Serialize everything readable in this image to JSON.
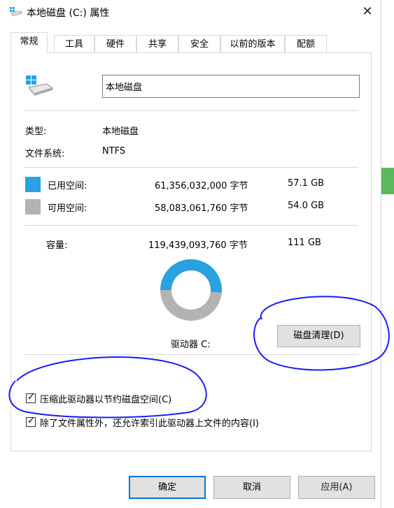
{
  "window": {
    "title": "本地磁盘 (C:) 属性",
    "close_glyph": "✕"
  },
  "tabs": [
    {
      "label": "常规"
    },
    {
      "label": "工具"
    },
    {
      "label": "硬件"
    },
    {
      "label": "共享"
    },
    {
      "label": "安全"
    },
    {
      "label": "以前的版本"
    },
    {
      "label": "配额"
    }
  ],
  "general": {
    "drive_name": "本地磁盘",
    "type_label": "类型:",
    "type_value": "本地磁盘",
    "fs_label": "文件系统:",
    "fs_value": "NTFS",
    "used": {
      "label": "已用空间:",
      "bytes": "61,356,032,000 字节",
      "size": "57.1 GB",
      "color": "#2aa1e0"
    },
    "free": {
      "label": "可用空间:",
      "bytes": "58,083,061,760 字节",
      "size": "54.0 GB",
      "color": "#b3b3b3"
    },
    "capacity": {
      "label": "容量:",
      "bytes": "119,439,093,760 字节",
      "size": "111 GB"
    },
    "used_fraction": 0.514,
    "drive_label": "驱动器 C:",
    "cleanup_button": "磁盘清理(D)",
    "compress_checkbox": "压缩此驱动器以节约磁盘空间(C)",
    "index_checkbox": "除了文件属性外，还允许索引此驱动器上文件的内容(I)",
    "checkmark": "✓"
  },
  "buttons": {
    "ok": "确定",
    "cancel": "取消",
    "apply": "应用(A)"
  },
  "icons": {
    "title": "drive-icon",
    "drive": "windows-drive-icon"
  },
  "colors": {
    "accent": "#0078d7",
    "annotation": "#1a1aff"
  }
}
